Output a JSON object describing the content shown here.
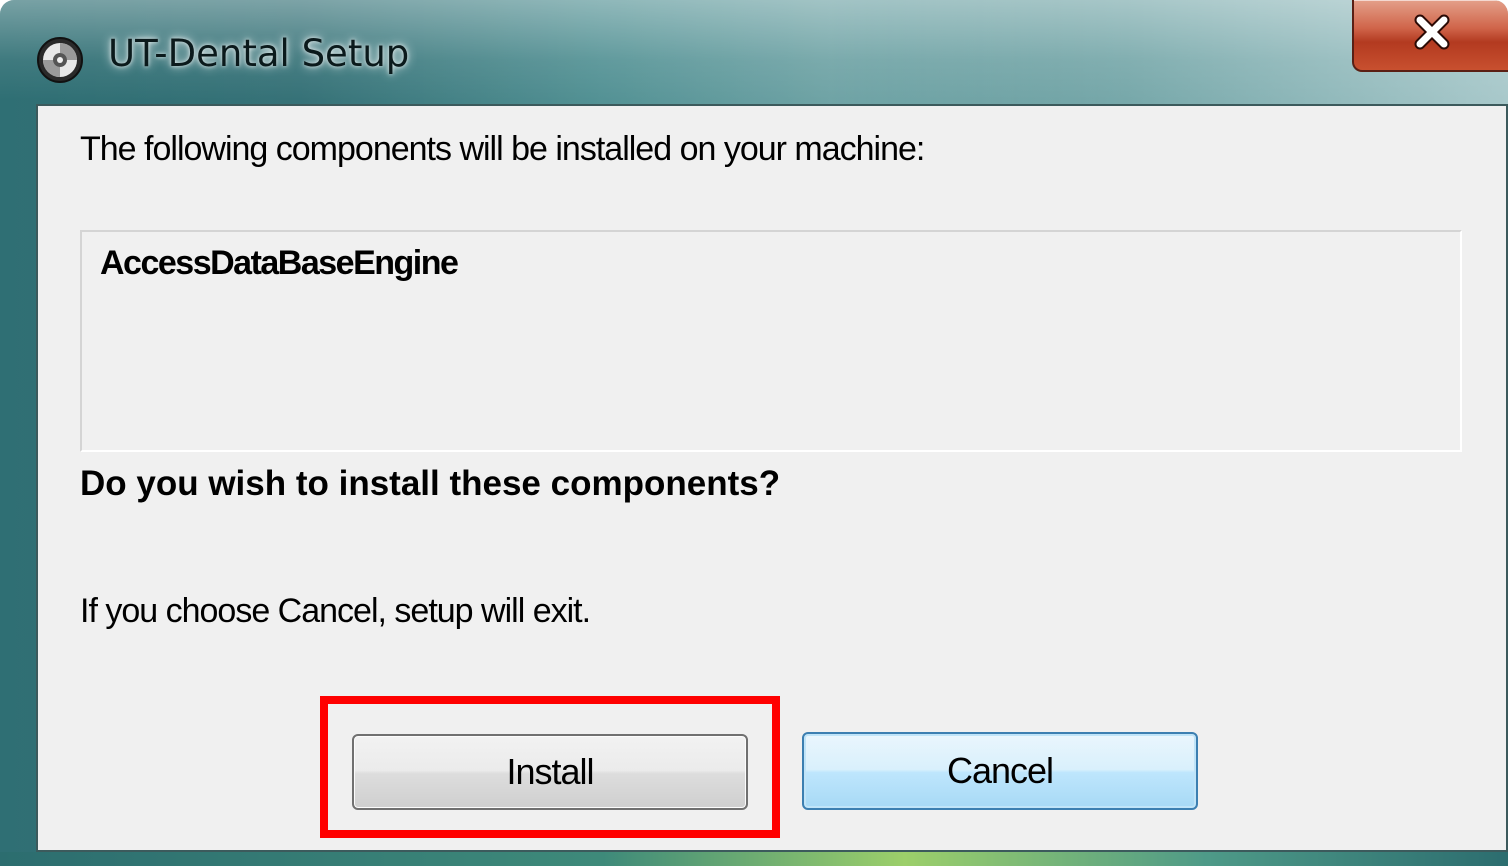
{
  "window": {
    "title": "UT-Dental Setup",
    "title_icon": "setup-disc-icon",
    "close_icon": "close-icon"
  },
  "dialog": {
    "intro": "The following components will be installed on your machine:",
    "components": [
      "AccessDataBaseEngine"
    ],
    "question": "Do you wish to install these components?",
    "cancel_note": "If you choose Cancel, setup will exit."
  },
  "buttons": {
    "install_label": "Install",
    "cancel_label": "Cancel"
  },
  "colors": {
    "highlight": "#ff0000",
    "close_button": "#c8502f",
    "focused_button_border": "#3c7fb1",
    "client_background": "#f0f0f0"
  }
}
